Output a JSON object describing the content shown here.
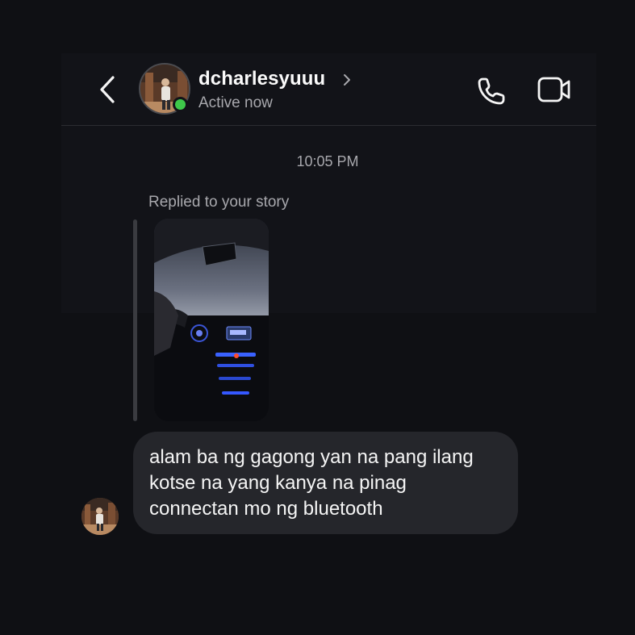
{
  "header": {
    "username": "dcharlesyuuu",
    "status": "Active now",
    "back_icon": "chevron-left-icon",
    "profile_chevron_icon": "chevron-right-icon",
    "call_icon": "phone-icon",
    "video_icon": "video-camera-icon",
    "online_color": "#3ec84a"
  },
  "thread": {
    "timestamp": "10:05 PM",
    "reply_context": "Replied to your story",
    "message": {
      "text": "alam ba ng gagong yan na pang ilang\nkotse na yang kanya na pinag\nconnectan mo ng bluetooth",
      "bubble_color": "#25262b"
    }
  },
  "colors": {
    "background": "#0f1014",
    "secondary_text": "#a8a8ad",
    "primary_text": "#f5f5f5"
  }
}
